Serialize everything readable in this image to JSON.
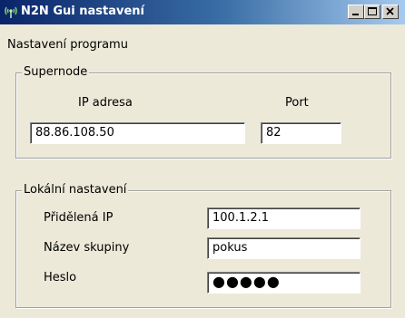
{
  "window": {
    "title": "N2N Gui nastavení",
    "icon": "network-antenna-icon"
  },
  "main": {
    "heading": "Nastavení programu"
  },
  "supernode": {
    "group_label": "Supernode",
    "ip_label": "IP adresa",
    "ip_value": "88.86.108.50",
    "port_label": "Port",
    "port_value": "82"
  },
  "local": {
    "group_label": "Lokální nastavení",
    "assigned_ip_label": "Přidělená IP",
    "assigned_ip_value": "100.1.2.1",
    "group_name_label": "Název skupiny",
    "group_name_value": "pokus",
    "password_label": "Heslo",
    "password_value": "●●●●●"
  },
  "colors": {
    "titlebar_start": "#0a246a",
    "titlebar_end": "#a6caf0",
    "dialog_bg": "#ece9d8"
  }
}
